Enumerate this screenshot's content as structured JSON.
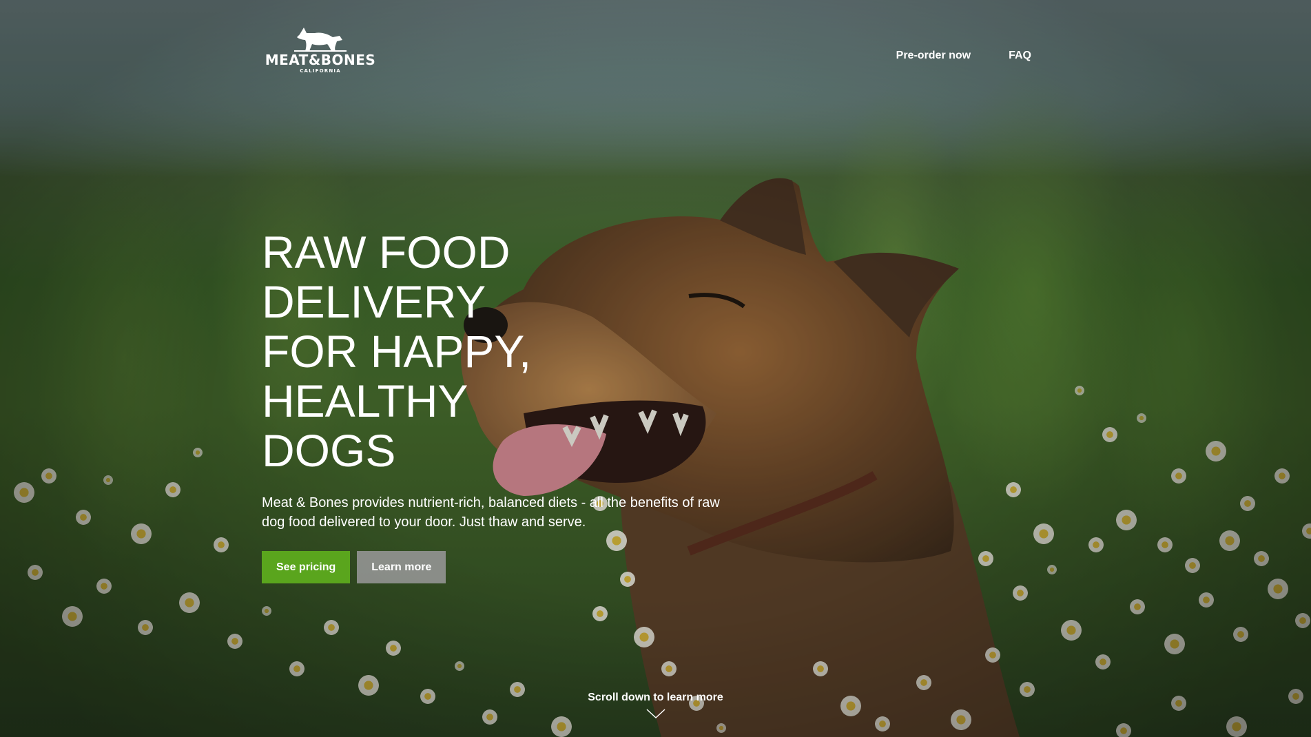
{
  "brand": {
    "name": "MEAT&BONES",
    "subtitle": "CALIFORNIA",
    "logo_icon": "dog-icon"
  },
  "nav": {
    "items": [
      {
        "label": "Pre-order now"
      },
      {
        "label": "FAQ"
      }
    ]
  },
  "hero": {
    "headline_lines": [
      "RAW FOOD DELIVERY",
      "FOR HAPPY, HEALTHY",
      "DOGS"
    ],
    "subcopy": "Meat & Bones provides nutrient-rich, balanced diets - all the benefits of raw dog food delivered to your door. Just thaw and serve.",
    "primary_button": "See pricing",
    "secondary_button": "Learn more",
    "scroll_hint": "Scroll down to learn more",
    "scroll_icon": "chevron-down-icon"
  },
  "colors": {
    "primary_button": "#5aa51d",
    "secondary_button": "#969696",
    "text": "#ffffff"
  }
}
